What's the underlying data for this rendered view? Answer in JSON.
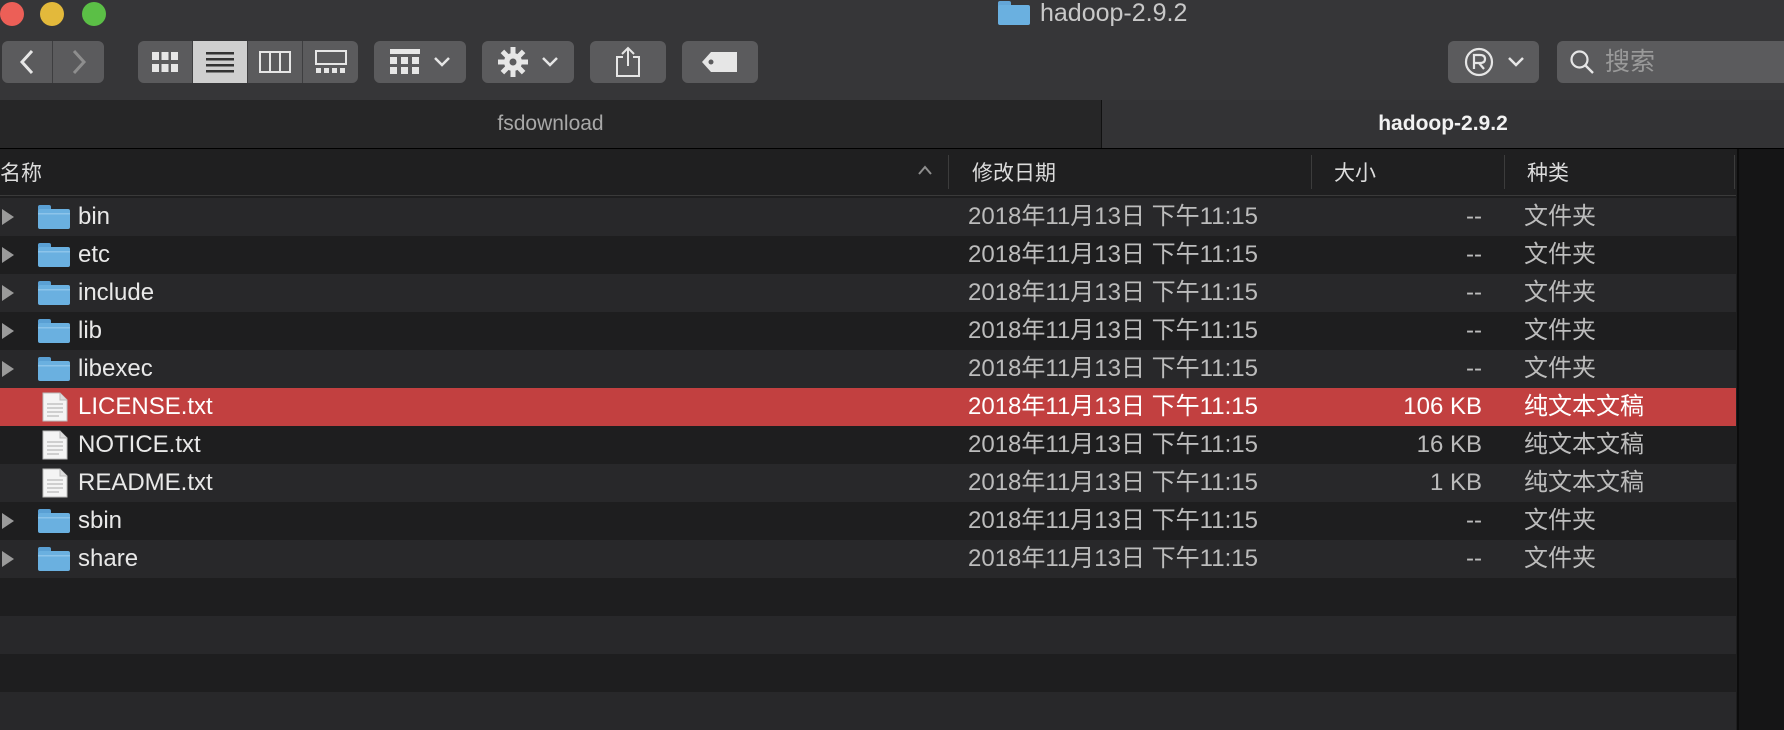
{
  "window": {
    "title": "hadoop-2.9.2"
  },
  "toolbar": {
    "back": "chevron-left-icon",
    "forward": "chevron-right-icon",
    "views": [
      "icon-view",
      "list-view",
      "column-view",
      "gallery-view"
    ],
    "active_view": "list-view",
    "group_by": "group-grid-icon",
    "action": "gear-icon",
    "share": "share-icon",
    "tag": "tag-icon",
    "app_button": "registered-icon",
    "search_placeholder": "搜索"
  },
  "tabs": [
    {
      "label": "fsdownload",
      "active": false
    },
    {
      "label": "hadoop-2.9.2",
      "active": true
    }
  ],
  "columns": {
    "name": "名称",
    "date": "修改日期",
    "size": "大小",
    "kind": "种类"
  },
  "files": [
    {
      "name": "bin",
      "date": "2018年11月13日 下午11:15",
      "size": "--",
      "kind": "文件夹",
      "type": "folder",
      "selected": false
    },
    {
      "name": "etc",
      "date": "2018年11月13日 下午11:15",
      "size": "--",
      "kind": "文件夹",
      "type": "folder",
      "selected": false
    },
    {
      "name": "include",
      "date": "2018年11月13日 下午11:15",
      "size": "--",
      "kind": "文件夹",
      "type": "folder",
      "selected": false
    },
    {
      "name": "lib",
      "date": "2018年11月13日 下午11:15",
      "size": "--",
      "kind": "文件夹",
      "type": "folder",
      "selected": false
    },
    {
      "name": "libexec",
      "date": "2018年11月13日 下午11:15",
      "size": "--",
      "kind": "文件夹",
      "type": "folder",
      "selected": false
    },
    {
      "name": "LICENSE.txt",
      "date": "2018年11月13日 下午11:15",
      "size": "106 KB",
      "kind": "纯文本文稿",
      "type": "file",
      "selected": true
    },
    {
      "name": "NOTICE.txt",
      "date": "2018年11月13日 下午11:15",
      "size": "16 KB",
      "kind": "纯文本文稿",
      "type": "file",
      "selected": false
    },
    {
      "name": "README.txt",
      "date": "2018年11月13日 下午11:15",
      "size": "1 KB",
      "kind": "纯文本文稿",
      "type": "file",
      "selected": false
    },
    {
      "name": "sbin",
      "date": "2018年11月13日 下午11:15",
      "size": "--",
      "kind": "文件夹",
      "type": "folder",
      "selected": false
    },
    {
      "name": "share",
      "date": "2018年11月13日 下午11:15",
      "size": "--",
      "kind": "文件夹",
      "type": "folder",
      "selected": false
    }
  ],
  "colors": {
    "selection": "#c24040",
    "folder": "#6ab0e0",
    "close": "#ec5f57",
    "minimize": "#e3b93b",
    "maximize": "#5bbf46"
  }
}
